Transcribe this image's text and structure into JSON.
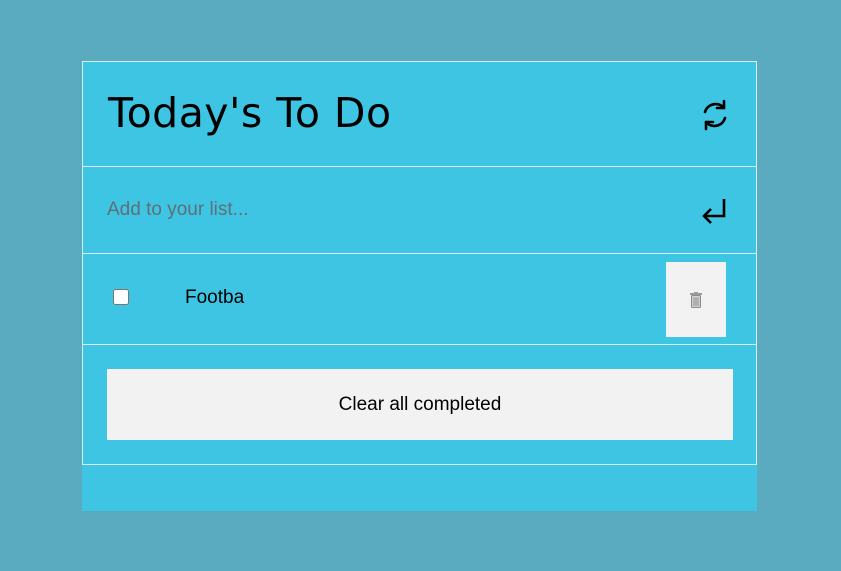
{
  "app": {
    "title": "Today's To Do"
  },
  "header": {
    "refresh_icon": "refresh-icon"
  },
  "add": {
    "placeholder": "Add to your list...",
    "value": "",
    "submit_icon": "enter-icon"
  },
  "items": [
    {
      "text": "Footba",
      "checked": false,
      "delete_icon": "trash-icon"
    }
  ],
  "footer": {
    "clear_label": "Clear all completed"
  },
  "colors": {
    "background": "#5aabc0",
    "card": "#3ec5e4",
    "button": "#f2f2f2",
    "divider": "#d6eef5"
  }
}
